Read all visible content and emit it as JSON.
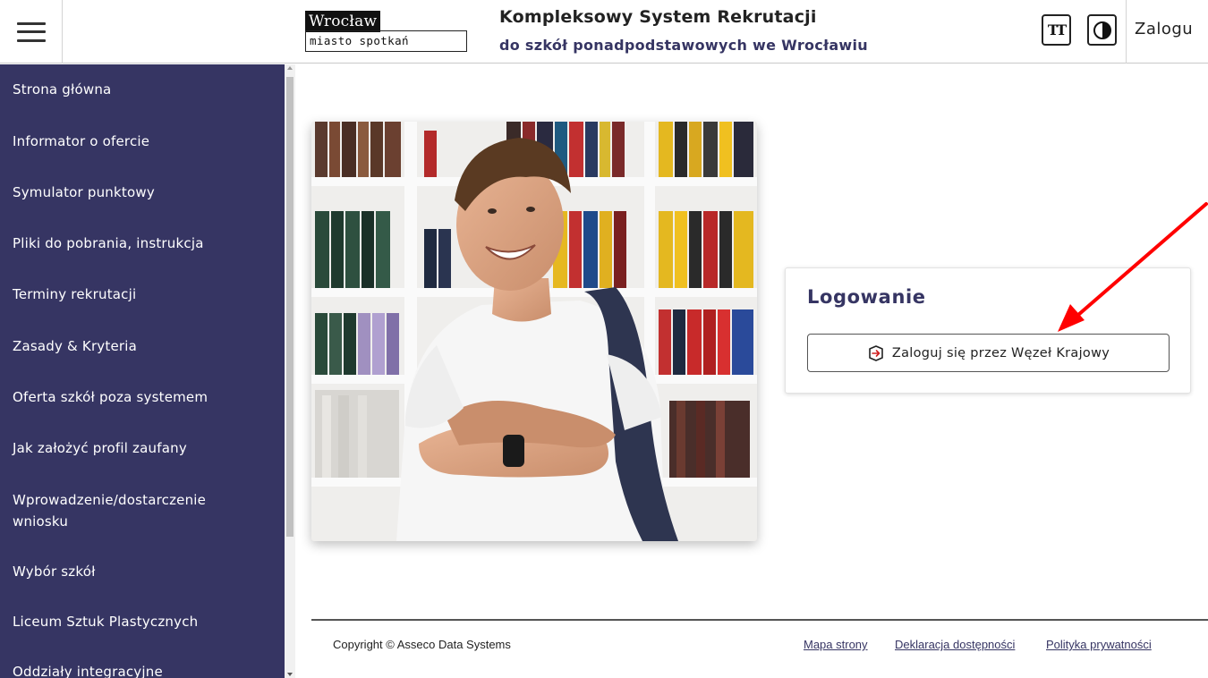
{
  "header": {
    "logo_top": "Wrocław",
    "logo_bottom": "miasto spotkań",
    "title": "Kompleksowy System Rekrutacji",
    "subtitle": "do szkół ponadpodstawowych we Wrocławiu",
    "font_size_button": "TT",
    "login_link": "Zalogu"
  },
  "sidebar": {
    "items": [
      "Strona główna",
      "Informator o ofercie",
      "Symulator punktowy",
      "Pliki do pobrania, instrukcja",
      "Terminy rekrutacji",
      "Zasady & Kryteria",
      "Oferta szkół poza systemem",
      "Jak założyć profil zaufany",
      "Wprowadzenie/dostarczenie",
      "wniosku",
      "Wybór szkół",
      "Liceum Sztuk Plastycznych",
      "Oddziały integracyjne"
    ]
  },
  "login": {
    "title": "Logowanie",
    "button_label": "Zaloguj się przez Węzeł Krajowy"
  },
  "footer": {
    "copyright": "Copyright © Asseco Data Systems",
    "links": [
      "Mapa strony",
      "Deklaracja dostępności",
      "Polityka prywatności"
    ]
  },
  "colors": {
    "sidebar_bg": "#363563",
    "accent": "#363563",
    "annotation_arrow": "#ff0000"
  },
  "icons": [
    "menu-icon",
    "font-size-icon",
    "contrast-icon",
    "login-icon"
  ]
}
